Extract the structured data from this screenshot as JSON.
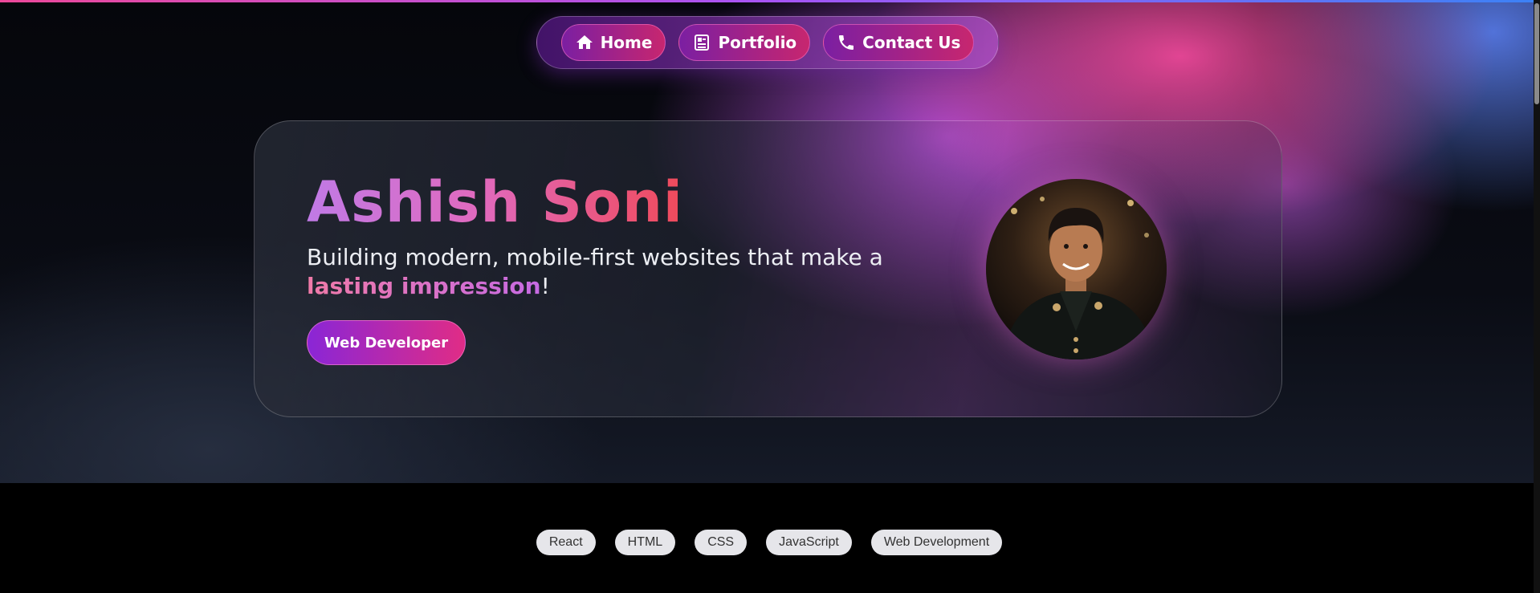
{
  "nav": {
    "items": [
      {
        "label": "Home",
        "icon": "home-icon"
      },
      {
        "label": "Portfolio",
        "icon": "newspaper-icon"
      },
      {
        "label": "Contact Us",
        "icon": "phone-icon"
      }
    ]
  },
  "hero": {
    "name": "Ashish Soni",
    "tagline_prefix": "Building modern, mobile-first websites that make a ",
    "tagline_highlight": "lasting impression",
    "tagline_suffix": "!",
    "role_button": "Web Developer",
    "avatar_alt": "avatar"
  },
  "tags": [
    "React",
    "HTML",
    "CSS",
    "JavaScript",
    "Web Development"
  ],
  "colors": {
    "accent_pink": "#ec4899",
    "accent_purple": "#a855f7",
    "accent_blue": "#5678e4",
    "name_gradient_start": "#c07ae6",
    "name_gradient_end": "#ef4a5a"
  }
}
